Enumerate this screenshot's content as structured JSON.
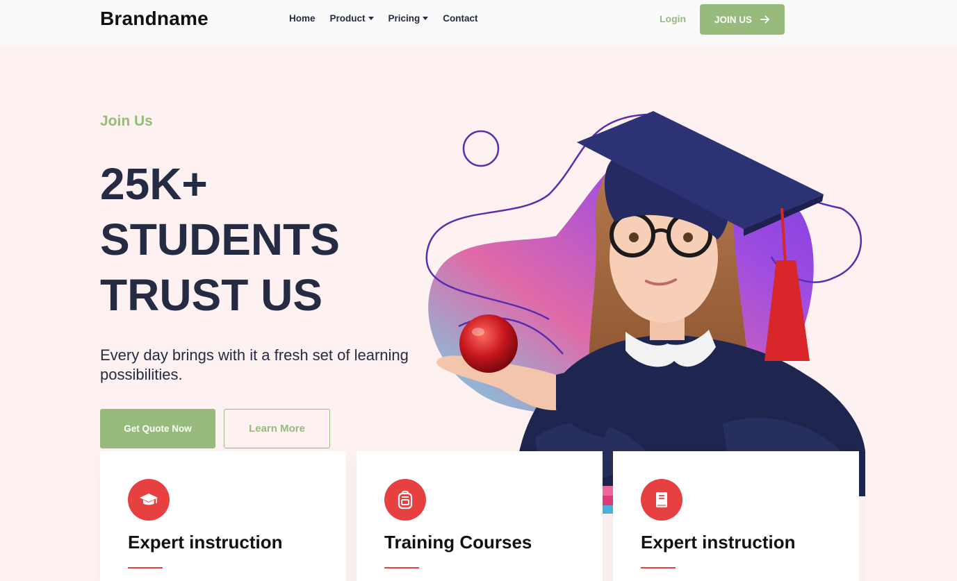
{
  "nav": {
    "brand": "Brandname",
    "menu": [
      {
        "label": "Home",
        "has_dropdown": false
      },
      {
        "label": "Product",
        "has_dropdown": true
      },
      {
        "label": "Pricing",
        "has_dropdown": true
      },
      {
        "label": "Contact",
        "has_dropdown": false
      }
    ],
    "login": "Login",
    "join": "JOIN US",
    "join_icon": "arrow-right-icon"
  },
  "hero": {
    "kicker": "Join Us",
    "headline": [
      "25K+",
      "STUDENTS",
      "TRUST US"
    ],
    "subtitle": "Every day brings with it a fresh set of learning possibilities.",
    "primary_cta": "Get Quote Now",
    "secondary_cta": "Learn More",
    "image_subject": "girl-in-graduation-cap-holding-apple"
  },
  "cards": [
    {
      "title": "Expert instruction",
      "icon": "graduation-cap-icon"
    },
    {
      "title": "Training Courses",
      "icon": "backpack-icon"
    },
    {
      "title": "Expert instruction",
      "icon": "book-icon"
    }
  ],
  "colors": {
    "accent_green": "#96bb7c",
    "heading_dark": "#252b42",
    "card_red": "#e74040",
    "hero_bg": "#fdf1f1",
    "outline_purple": "#5b2bb0"
  }
}
